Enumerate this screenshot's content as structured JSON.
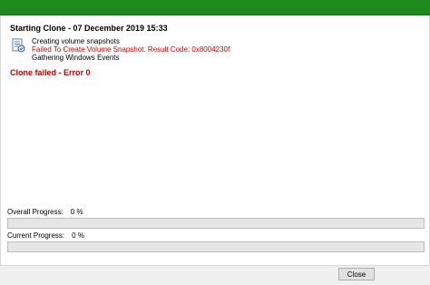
{
  "window": {
    "accent_color": "#1e8a1e"
  },
  "log": {
    "heading": "Starting Clone - 07 December 2019  15:33",
    "icon": "snapshot-document-icon",
    "lines": [
      "Creating volume snapshots",
      "Failed To Create Volume Snapshot. Result Code: 0x8004230f",
      "Gathering Windows Events"
    ],
    "error_color": "#d40000",
    "status": "Clone failed - Error 0"
  },
  "progress": {
    "overall": {
      "label": "Overall Progress:",
      "value_text": "0 %",
      "fraction": 0
    },
    "current": {
      "label": "Current Progress:",
      "value_text": "0 %",
      "fraction": 0
    }
  },
  "footer": {
    "close_label": "Close"
  }
}
